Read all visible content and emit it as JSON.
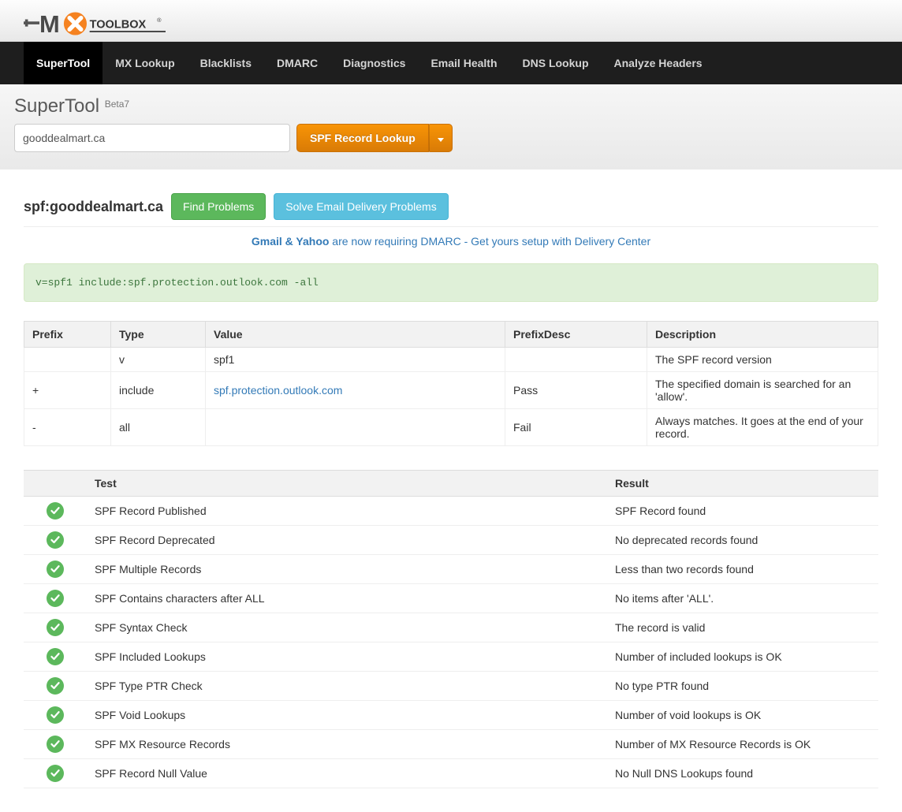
{
  "nav": {
    "items": [
      {
        "label": "SuperTool"
      },
      {
        "label": "MX Lookup"
      },
      {
        "label": "Blacklists"
      },
      {
        "label": "DMARC"
      },
      {
        "label": "Diagnostics"
      },
      {
        "label": "Email Health"
      },
      {
        "label": "DNS Lookup"
      },
      {
        "label": "Analyze Headers"
      }
    ]
  },
  "tool": {
    "title": "SuperTool",
    "beta": "Beta7",
    "input_value": "gooddealmart.ca",
    "lookup_btn": "SPF Record Lookup"
  },
  "result": {
    "title": "spf:gooddealmart.ca",
    "find_btn": "Find Problems",
    "solve_btn": "Solve Email Delivery Problems"
  },
  "notice": {
    "bold": "Gmail & Yahoo",
    "rest": " are now requiring DMARC - Get yours setup with Delivery Center"
  },
  "spf_record": "v=spf1 include:spf.protection.outlook.com -all",
  "record_table": {
    "headers": [
      "Prefix",
      "Type",
      "Value",
      "PrefixDesc",
      "Description"
    ],
    "rows": [
      {
        "prefix": "",
        "type": "v",
        "value": "spf1",
        "value_link": false,
        "prefixdesc": "",
        "desc": "The SPF record version"
      },
      {
        "prefix": "+",
        "type": "include",
        "value": "spf.protection.outlook.com",
        "value_link": true,
        "prefixdesc": "Pass",
        "desc": "The specified domain is searched for an 'allow'."
      },
      {
        "prefix": "-",
        "type": "all",
        "value": "",
        "value_link": false,
        "prefixdesc": "Fail",
        "desc": "Always matches. It goes at the end of your record."
      }
    ]
  },
  "tests_table": {
    "headers": [
      "",
      "Test",
      "Result"
    ],
    "rows": [
      {
        "test": "SPF Record Published",
        "result": "SPF Record found"
      },
      {
        "test": "SPF Record Deprecated",
        "result": "No deprecated records found"
      },
      {
        "test": "SPF Multiple Records",
        "result": "Less than two records found"
      },
      {
        "test": "SPF Contains characters after ALL",
        "result": "No items after 'ALL'."
      },
      {
        "test": "SPF Syntax Check",
        "result": "The record is valid"
      },
      {
        "test": "SPF Included Lookups",
        "result": "Number of included lookups is OK"
      },
      {
        "test": "SPF Type PTR Check",
        "result": "No type PTR found"
      },
      {
        "test": "SPF Void Lookups",
        "result": "Number of void lookups is OK"
      },
      {
        "test": "SPF MX Resource Records",
        "result": "Number of MX Resource Records is OK"
      },
      {
        "test": "SPF Record Null Value",
        "result": "No Null DNS Lookups found"
      }
    ]
  }
}
